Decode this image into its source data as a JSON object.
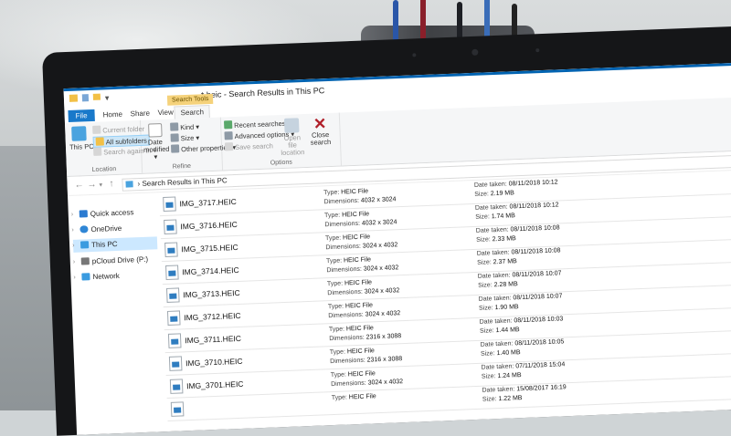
{
  "window": {
    "title": "*.heic - Search Results in This PC"
  },
  "ribbon": {
    "tabs": [
      "File",
      "Home",
      "Share",
      "View",
      "Search"
    ],
    "context_tab": "Search Tools",
    "location": {
      "this_pc": "This PC",
      "current_folder": "Current folder",
      "all_subfolders": "All subfolders",
      "search_again_in": "Search again in",
      "label": "Location"
    },
    "refine": {
      "date_modified": "Date modified",
      "kind": "Kind",
      "size": "Size",
      "other_properties": "Other properties",
      "label": "Refine"
    },
    "options": {
      "recent_searches": "Recent searches",
      "advanced_options": "Advanced options",
      "save_search": "Save search",
      "open_file_location": "Open file location",
      "close_search": "Close search",
      "label": "Options"
    }
  },
  "address": {
    "path": "Search Results in This PC"
  },
  "nav": {
    "items": [
      {
        "label": "Quick access",
        "icon": "star-icon",
        "color": "#2b7bd1"
      },
      {
        "label": "OneDrive",
        "icon": "cloud-icon",
        "color": "#2f86d6"
      },
      {
        "label": "This PC",
        "icon": "computer-icon",
        "color": "#3a9be0"
      },
      {
        "label": "pCloud Drive (P:)",
        "icon": "drive-icon",
        "color": "#777777"
      },
      {
        "label": "Network",
        "icon": "network-icon",
        "color": "#3a9be0"
      }
    ]
  },
  "labels": {
    "type": "Type:",
    "dimensions": "Dimensions:",
    "date_taken": "Date taken:",
    "size": "Size:"
  },
  "files": [
    {
      "name": "IMG_3717.HEIC",
      "type": "HEIC File",
      "dimensions": "4032 x 3024",
      "date_taken": "08/11/2018 10:12",
      "size": "2.19 MB"
    },
    {
      "name": "IMG_3716.HEIC",
      "type": "HEIC File",
      "dimensions": "4032 x 3024",
      "date_taken": "08/11/2018 10:12",
      "size": "1.74 MB"
    },
    {
      "name": "IMG_3715.HEIC",
      "type": "HEIC File",
      "dimensions": "3024 x 4032",
      "date_taken": "08/11/2018 10:08",
      "size": "2.33 MB"
    },
    {
      "name": "IMG_3714.HEIC",
      "type": "HEIC File",
      "dimensions": "3024 x 4032",
      "date_taken": "08/11/2018 10:08",
      "size": "2.37 MB"
    },
    {
      "name": "IMG_3713.HEIC",
      "type": "HEIC File",
      "dimensions": "3024 x 4032",
      "date_taken": "08/11/2018 10:07",
      "size": "2.28 MB"
    },
    {
      "name": "IMG_3712.HEIC",
      "type": "HEIC File",
      "dimensions": "3024 x 4032",
      "date_taken": "08/11/2018 10:07",
      "size": "1.90 MB"
    },
    {
      "name": "IMG_3711.HEIC",
      "type": "HEIC File",
      "dimensions": "2316 x 3088",
      "date_taken": "08/11/2018 10:03",
      "size": "1.44 MB"
    },
    {
      "name": "IMG_3710.HEIC",
      "type": "HEIC File",
      "dimensions": "2316 x 3088",
      "date_taken": "08/11/2018 10:05",
      "size": "1.40 MB"
    },
    {
      "name": "IMG_3701.HEIC",
      "type": "HEIC File",
      "dimensions": "3024 x 4032",
      "date_taken": "07/11/2018 15:04",
      "size": "1.24 MB"
    },
    {
      "name": "",
      "type": "HEIC File",
      "dimensions": "",
      "date_taken": "15/08/2017 16:19",
      "size": "1.22 MB"
    }
  ]
}
